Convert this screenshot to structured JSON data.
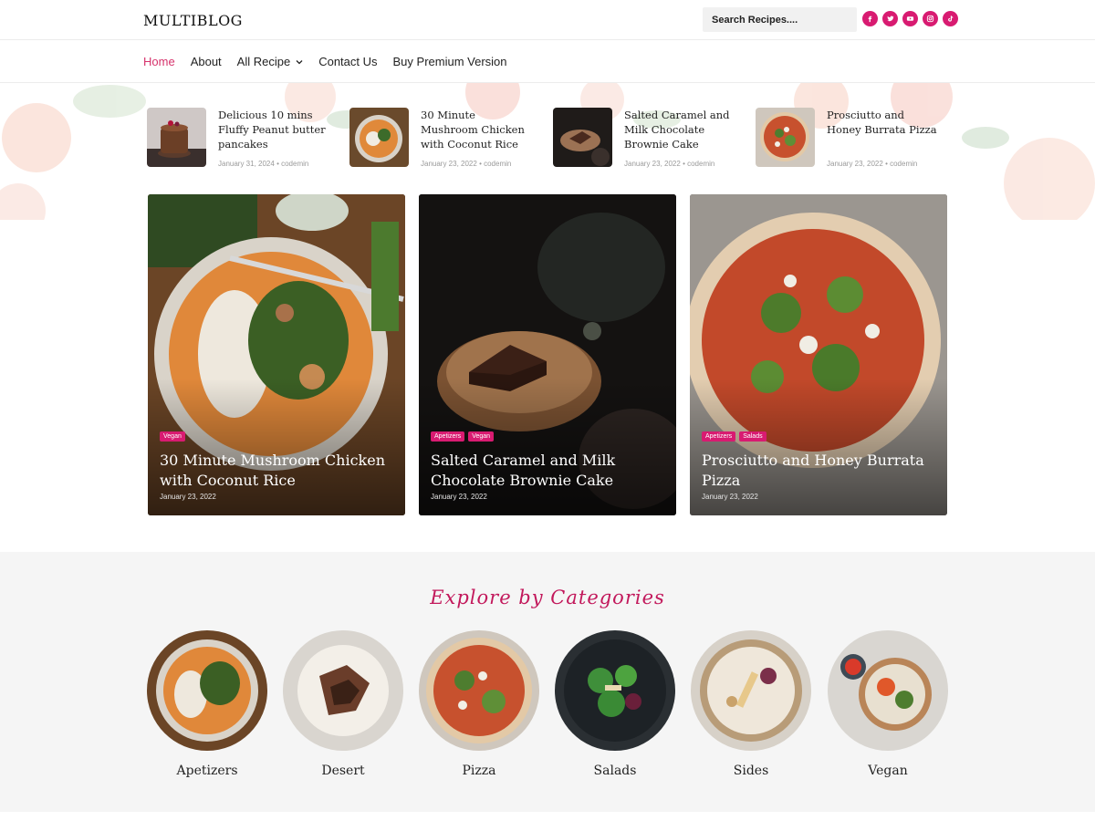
{
  "header": {
    "logo": "MULTIBLOG",
    "search_placeholder": "Search Recipes....",
    "socials": [
      "facebook-icon",
      "twitter-icon",
      "youtube-icon",
      "instagram-icon",
      "tiktok-icon"
    ],
    "accent_color": "#d81b71"
  },
  "nav": {
    "items": [
      {
        "label": "Home",
        "active": true
      },
      {
        "label": "About"
      },
      {
        "label": "All Recipe",
        "has_dropdown": true
      },
      {
        "label": "Contact Us"
      },
      {
        "label": "Buy Premium Version"
      }
    ]
  },
  "strip_posts": [
    {
      "title": "Delicious 10 mins Fluffy Peanut butter pancakes",
      "date": "January 31, 2024",
      "author": "codemin"
    },
    {
      "title": "30 Minute Mushroom Chicken with Coconut Rice",
      "date": "January 23, 2022",
      "author": "codemin"
    },
    {
      "title": "Salted Caramel and Milk Chocolate Brownie Cake",
      "date": "January 23, 2022",
      "author": "codemin"
    },
    {
      "title": "Prosciutto and Honey Burrata Pizza",
      "date": "January 23, 2022",
      "author": "codemin"
    }
  ],
  "meta_separator": "•",
  "featured": [
    {
      "tags": [
        "Vegan"
      ],
      "title": "30 Minute Mushroom Chicken with Coconut Rice",
      "date": "January 23, 2022"
    },
    {
      "tags": [
        "Apetizers",
        "Vegan"
      ],
      "title": "Salted Caramel and Milk Chocolate Brownie Cake",
      "date": "January 23, 2022"
    },
    {
      "tags": [
        "Apetizers",
        "Salads"
      ],
      "title": "Prosciutto and Honey Burrata Pizza",
      "date": "January 23, 2022"
    }
  ],
  "categories": {
    "heading": "Explore by Categories",
    "items": [
      {
        "label": "Apetizers"
      },
      {
        "label": "Desert"
      },
      {
        "label": "Pizza"
      },
      {
        "label": "Salads"
      },
      {
        "label": "Sides"
      },
      {
        "label": "Vegan"
      }
    ]
  }
}
